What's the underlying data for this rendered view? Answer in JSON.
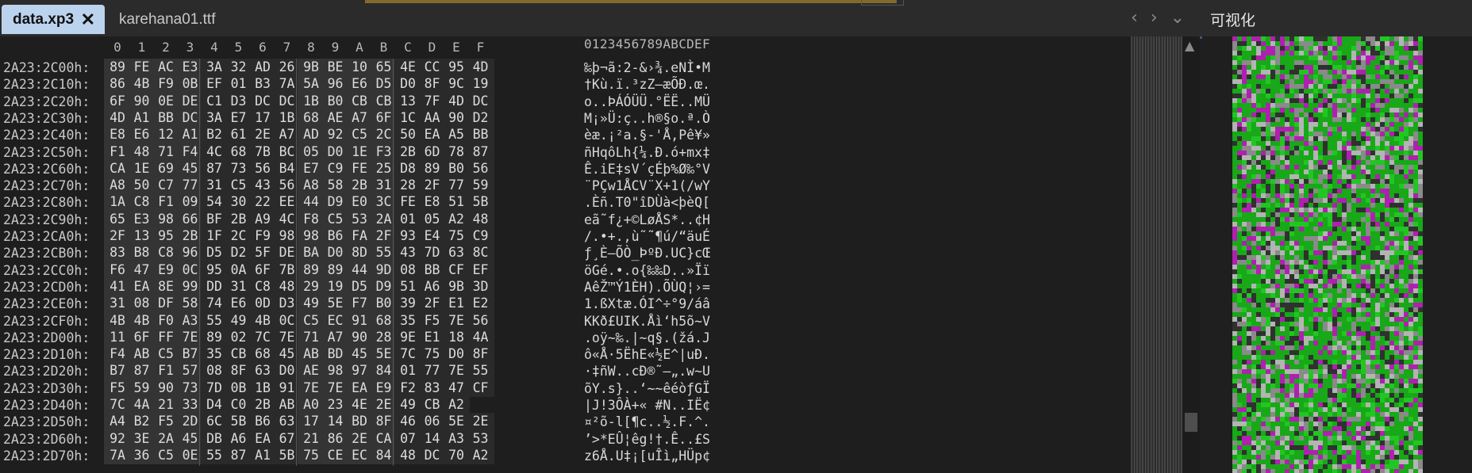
{
  "tabs": [
    {
      "label": "data.xp3",
      "active": true
    },
    {
      "label": "karehana01.ttf",
      "active": false
    }
  ],
  "tab_close_glyph": "✕",
  "nav": {
    "prev": "‹",
    "next": "›",
    "menu": "⌄"
  },
  "viz_panel": {
    "title": "可视化"
  },
  "hex": {
    "column_headers": [
      "0",
      "1",
      "2",
      "3",
      "4",
      "5",
      "6",
      "7",
      "8",
      "9",
      "A",
      "B",
      "C",
      "D",
      "E",
      "F"
    ],
    "ascii_header": "0123456789ABCDEF",
    "rows": [
      {
        "addr": "2A23:2C00h:",
        "bytes": [
          "89",
          "FE",
          "AC",
          "E3",
          "3A",
          "32",
          "AD",
          "26",
          "9B",
          "BE",
          "10",
          "65",
          "4E",
          "CC",
          "95",
          "4D"
        ],
        "ascii": "‰þ¬ã:2-&›¾.eNÌ•M"
      },
      {
        "addr": "2A23:2C10h:",
        "bytes": [
          "86",
          "4B",
          "F9",
          "0B",
          "EF",
          "01",
          "B3",
          "7A",
          "5A",
          "96",
          "E6",
          "D5",
          "D0",
          "8F",
          "9C",
          "19"
        ],
        "ascii": "†Kù.ï.³zZ–æÕÐ.œ."
      },
      {
        "addr": "2A23:2C20h:",
        "bytes": [
          "6F",
          "90",
          "0E",
          "DE",
          "C1",
          "D3",
          "DC",
          "DC",
          "1B",
          "B0",
          "CB",
          "CB",
          "13",
          "7F",
          "4D",
          "DC"
        ],
        "ascii": "o..ÞÁÓÜÜ.°ËË..MÜ"
      },
      {
        "addr": "2A23:2C30h:",
        "bytes": [
          "4D",
          "A1",
          "BB",
          "DC",
          "3A",
          "E7",
          "17",
          "1B",
          "68",
          "AE",
          "A7",
          "6F",
          "1C",
          "AA",
          "90",
          "D2"
        ],
        "ascii": "M¡»Ü:ç..h®§o.ª.Ò"
      },
      {
        "addr": "2A23:2C40h:",
        "bytes": [
          "E8",
          "E6",
          "12",
          "A1",
          "B2",
          "61",
          "2E",
          "A7",
          "AD",
          "92",
          "C5",
          "2C",
          "50",
          "EA",
          "A5",
          "BB"
        ],
        "ascii": "èæ.¡²a.§-'Å,Pê¥»"
      },
      {
        "addr": "2A23:2C50h:",
        "bytes": [
          "F1",
          "48",
          "71",
          "F4",
          "4C",
          "68",
          "7B",
          "BC",
          "05",
          "D0",
          "1E",
          "F3",
          "2B",
          "6D",
          "78",
          "87"
        ],
        "ascii": "ñHqôLh{¼.Ð.ó+mx‡"
      },
      {
        "addr": "2A23:2C60h:",
        "bytes": [
          "CA",
          "1E",
          "69",
          "45",
          "87",
          "73",
          "56",
          "B4",
          "E7",
          "C9",
          "FE",
          "25",
          "D8",
          "89",
          "B0",
          "56"
        ],
        "ascii": "Ê.iE‡sV´çÉþ%Ø‰°V"
      },
      {
        "addr": "2A23:2C70h:",
        "bytes": [
          "A8",
          "50",
          "C7",
          "77",
          "31",
          "C5",
          "43",
          "56",
          "A8",
          "58",
          "2B",
          "31",
          "28",
          "2F",
          "77",
          "59"
        ],
        "ascii": "¨PÇw1ÅCV¨X+1(/wY"
      },
      {
        "addr": "2A23:2C80h:",
        "bytes": [
          "1A",
          "C8",
          "F1",
          "09",
          "54",
          "30",
          "22",
          "EE",
          "44",
          "D9",
          "E0",
          "3C",
          "FE",
          "E8",
          "51",
          "5B"
        ],
        "ascii": ".Èñ.T0\"îDÙà<þèQ["
      },
      {
        "addr": "2A23:2C90h:",
        "bytes": [
          "65",
          "E3",
          "98",
          "66",
          "BF",
          "2B",
          "A9",
          "4C",
          "F8",
          "C5",
          "53",
          "2A",
          "01",
          "05",
          "A2",
          "48"
        ],
        "ascii": "eã˜f¿+©LøÅS*..¢H"
      },
      {
        "addr": "2A23:2CA0h:",
        "bytes": [
          "2F",
          "13",
          "95",
          "2B",
          "1F",
          "2C",
          "F9",
          "98",
          "98",
          "B6",
          "FA",
          "2F",
          "93",
          "E4",
          "75",
          "C9"
        ],
        "ascii": "/.•+.,ù˜˜¶ú/“äuÉ"
      },
      {
        "addr": "2A23:2CB0h:",
        "bytes": [
          "83",
          "B8",
          "C8",
          "96",
          "D5",
          "D2",
          "5F",
          "DE",
          "BA",
          "D0",
          "8D",
          "55",
          "43",
          "7D",
          "63",
          "8C"
        ],
        "ascii": "ƒ¸È–ÕÒ_ÞºÐ.UC}cŒ"
      },
      {
        "addr": "2A23:2CC0h:",
        "bytes": [
          "F6",
          "47",
          "E9",
          "0C",
          "95",
          "0A",
          "6F",
          "7B",
          "89",
          "89",
          "44",
          "9D",
          "08",
          "BB",
          "CF",
          "EF"
        ],
        "ascii": "öGé.•.o{‰‰D..»Ïï"
      },
      {
        "addr": "2A23:2CD0h:",
        "bytes": [
          "41",
          "EA",
          "8E",
          "99",
          "DD",
          "31",
          "C8",
          "48",
          "29",
          "19",
          "D5",
          "D9",
          "51",
          "A6",
          "9B",
          "3D"
        ],
        "ascii": "AêŽ™Ý1ÈH).ÕÙQ¦›="
      },
      {
        "addr": "2A23:2CE0h:",
        "bytes": [
          "31",
          "08",
          "DF",
          "58",
          "74",
          "E6",
          "0D",
          "D3",
          "49",
          "5E",
          "F7",
          "B0",
          "39",
          "2F",
          "E1",
          "E2"
        ],
        "ascii": "1.ßXtæ.ÓI^÷°9/áâ"
      },
      {
        "addr": "2A23:2CF0h:",
        "bytes": [
          "4B",
          "4B",
          "F0",
          "A3",
          "55",
          "49",
          "4B",
          "0C",
          "C5",
          "EC",
          "91",
          "68",
          "35",
          "F5",
          "7E",
          "56"
        ],
        "ascii": "KKð£UIK.Åì‘h5õ~V"
      },
      {
        "addr": "2A23:2D00h:",
        "bytes": [
          "11",
          "6F",
          "FF",
          "7E",
          "89",
          "02",
          "7C",
          "7E",
          "71",
          "A7",
          "90",
          "28",
          "9E",
          "E1",
          "18",
          "4A"
        ],
        "ascii": ".oÿ~‰.|~q§.(žá.J"
      },
      {
        "addr": "2A23:2D10h:",
        "bytes": [
          "F4",
          "AB",
          "C5",
          "B7",
          "35",
          "CB",
          "68",
          "45",
          "AB",
          "BD",
          "45",
          "5E",
          "7C",
          "75",
          "D0",
          "8F"
        ],
        "ascii": "ô«Å·5ËhE«½E^|uÐ."
      },
      {
        "addr": "2A23:2D20h:",
        "bytes": [
          "B7",
          "87",
          "F1",
          "57",
          "08",
          "8F",
          "63",
          "D0",
          "AE",
          "98",
          "97",
          "84",
          "01",
          "77",
          "7E",
          "55"
        ],
        "ascii": "·‡ñW..cÐ®˜—„.w~U"
      },
      {
        "addr": "2A23:2D30h:",
        "bytes": [
          "F5",
          "59",
          "90",
          "73",
          "7D",
          "0B",
          "1B",
          "91",
          "7E",
          "7E",
          "EA",
          "E9",
          "F2",
          "83",
          "47",
          "CF"
        ],
        "ascii": "õY.s}..‘~~êéòƒGÏ"
      },
      {
        "addr": "2A23:2D40h:",
        "bytes": [
          "7C",
          "4A",
          "21",
          "33",
          "D4",
          "C0",
          "2B",
          "AB",
          "A0",
          "23",
          "4E",
          "2E",
          "49",
          "CB",
          "A2"
        ],
        "ascii": "|J!3ÔÀ+« #N..IË¢"
      },
      {
        "addr": "2A23:2D50h:",
        "bytes": [
          "A4",
          "B2",
          "F5",
          "2D",
          "6C",
          "5B",
          "B6",
          "63",
          "17",
          "14",
          "BD",
          "8F",
          "46",
          "06",
          "5E",
          "2E"
        ],
        "ascii": "¤²õ-l[¶c..½.F.^."
      },
      {
        "addr": "2A23:2D60h:",
        "bytes": [
          "92",
          "3E",
          "2A",
          "45",
          "DB",
          "A6",
          "EA",
          "67",
          "21",
          "86",
          "2E",
          "CA",
          "07",
          "14",
          "A3",
          "53"
        ],
        "ascii": "’>*EÛ¦êg!†.Ê..£S"
      },
      {
        "addr": "2A23:2D70h:",
        "bytes": [
          "7A",
          "36",
          "C5",
          "0E",
          "55",
          "87",
          "A1",
          "5B",
          "75",
          "CE",
          "EC",
          "84",
          "48",
          "DC",
          "70",
          "A2"
        ],
        "ascii": "z6Å.U‡¡[uÎì„HÜp¢"
      }
    ]
  },
  "visualization": {
    "palette": {
      "green": "#18a818",
      "bright_green": "#22c622",
      "grey": "#8a8a8a",
      "light_grey": "#b4b4b4",
      "magenta": "#b020b0",
      "dark": "#303030"
    }
  }
}
